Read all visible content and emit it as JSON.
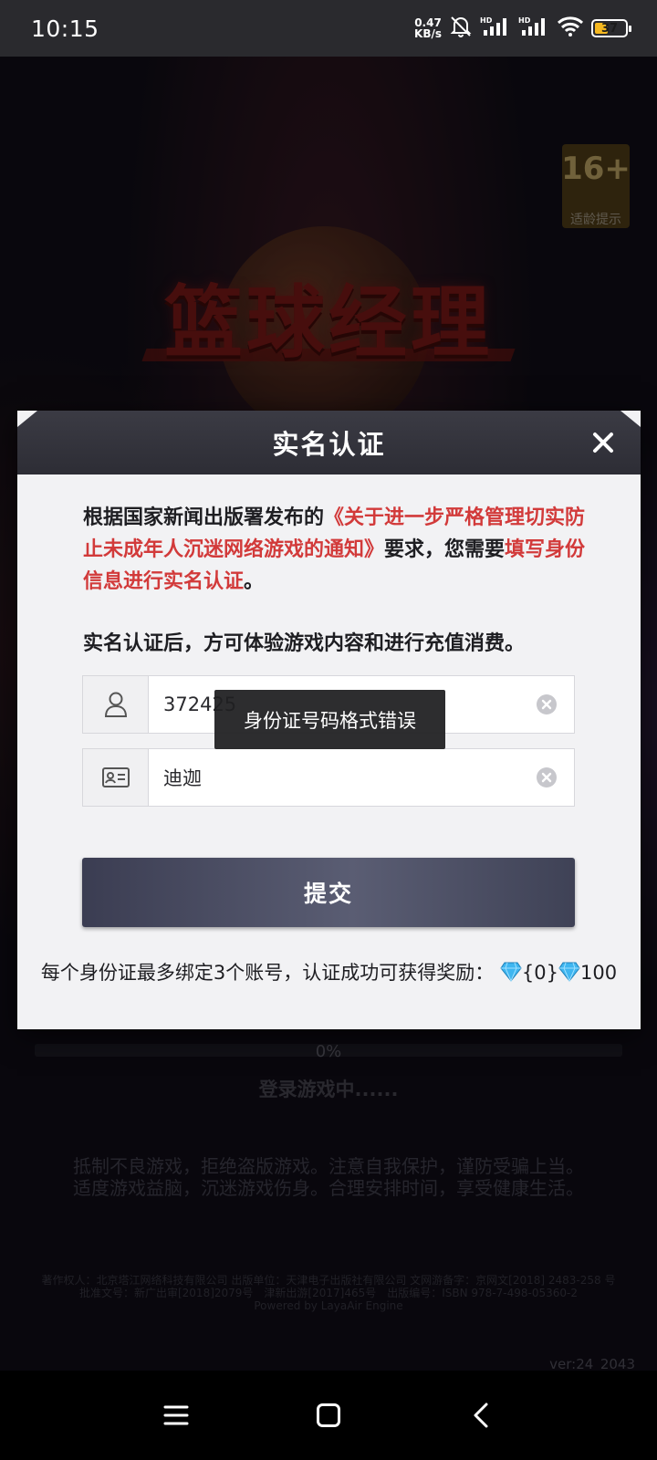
{
  "status_bar": {
    "time": "10:15",
    "net_speed_value": "0.47",
    "net_speed_unit": "KB/s",
    "sim1_label": "HD",
    "sim2_label": "HD",
    "battery_level": "37"
  },
  "background": {
    "age_rating": "16+",
    "age_hint": "适龄提示",
    "game_logo": "篮球经理",
    "progress_text": "0%",
    "loading_text": "登录游戏中......",
    "advisory_line1": "抵制不良游戏，拒绝盗版游戏。注意自我保护，谨防受骗上当。",
    "advisory_line2": "适度游戏益脑，沉迷游戏伤身。合理安排时间，享受健康生活。",
    "copyright_line1": "著作权人：北京塔江网络科技有限公司 出版单位：天津电子出版社有限公司 文网游备字：京网文[2018] 2483-258 号",
    "copyright_line2": "批准文号：新广出审[2018]2079号　津新出游[2017]465号　出版编号：ISBN 978-7-498-05360-2",
    "copyright_line3": "Powered by LayaAir Engine",
    "version": "ver:24_2043"
  },
  "dialog": {
    "title": "实名认证",
    "notice_part1": "根据国家新闻出版署发布的",
    "notice_link": "《关于进一步严格管理切实防止未成年人沉迷网络游戏的通知》",
    "notice_part2": "要求，您需要",
    "notice_emphasis": "填写身份信息进行实名认证",
    "notice_end": "。",
    "notice2": "实名认证后，方可体验游戏内容和进行充值消费。",
    "id_field_value": "372425",
    "name_field_value": "迪迦",
    "submit_label": "提交",
    "reward_prefix": "每个身份证最多绑定3个账号，认证成功可获得奖励：",
    "reward_mid": "{0}",
    "reward_amount": "100"
  },
  "toast": {
    "message": "身份证号码格式错误"
  },
  "colors": {
    "accent_red": "#d23a3a",
    "dialog_header": "#2d2d35",
    "submit_button": "#4a4c63",
    "gem": "#3fb6f0"
  },
  "icons": {
    "id_field": "user-icon",
    "name_field": "id-card-icon",
    "clear": "clear-circle-icon",
    "close": "close-icon",
    "reward": "diamond-icon",
    "nav_menu": "menu-icon",
    "nav_home": "home-square-icon",
    "nav_back": "back-chevron-icon"
  }
}
